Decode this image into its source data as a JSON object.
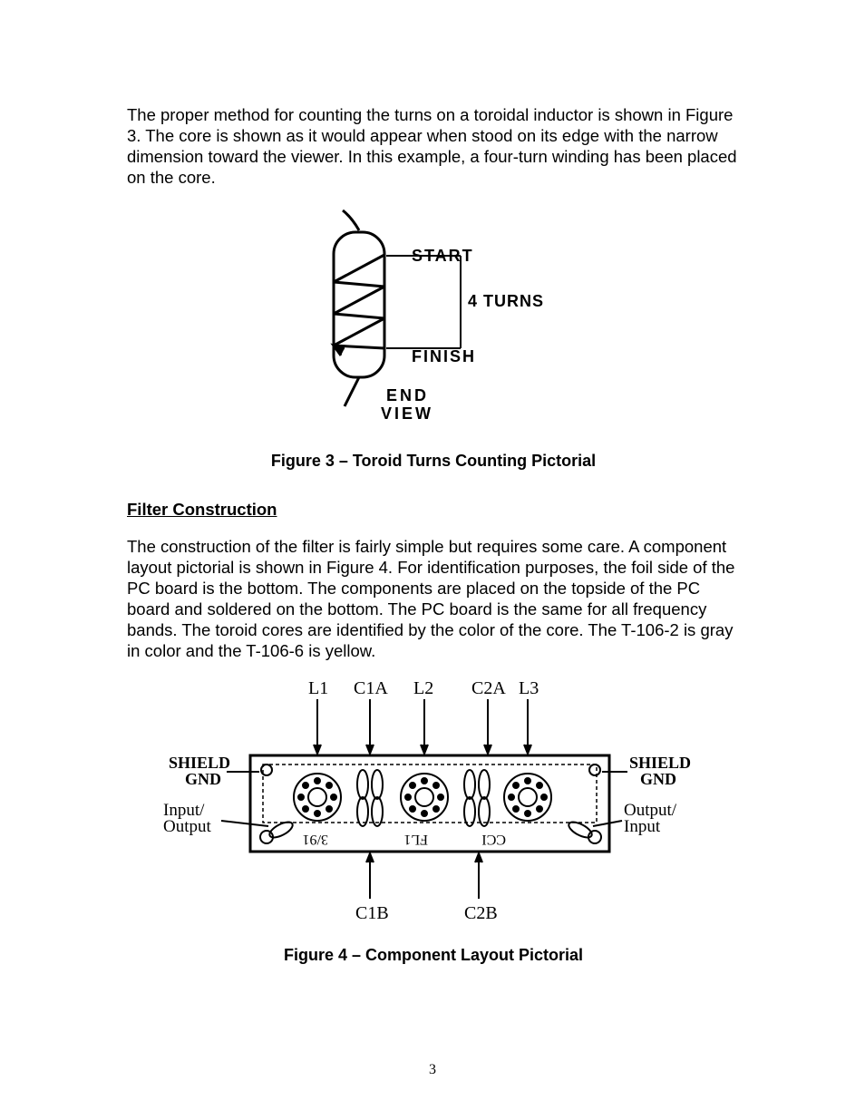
{
  "paragraph1": "The proper method for counting the turns on a toroidal inductor is shown in Figure 3.  The core is shown as it would appear when stood on its edge with the narrow dimension toward the viewer.  In this example, a four-turn winding has been placed on the core.",
  "figure3": {
    "caption": "Figure 3 – Toroid Turns Counting Pictorial",
    "labels": {
      "start": "START",
      "turns": "4 TURNS",
      "finish": "FINISH",
      "end": "END",
      "view": "VIEW"
    }
  },
  "section_heading": "Filter Construction",
  "paragraph2": "The construction of the filter is fairly simple but requires some care.  A component layout pictorial is shown in Figure 4.  For identification purposes, the foil side of the PC board is the bottom.  The components are placed on the topside of the PC board and soldered on the bottom.  The PC board is the same for all frequency bands.  The toroid cores are identified by the color of the core.  The T-106-2 is gray in color and the T-106-6 is yellow.",
  "figure4": {
    "caption": "Figure 4 – Component Layout Pictorial",
    "labels": {
      "L1": "L1",
      "C1A": "C1A",
      "L2": "L2",
      "C2A": "C2A",
      "L3": "L3",
      "shield_left": "SHIELD",
      "gnd_left": "GND",
      "input_left": "Input/",
      "output_left": "Output",
      "shield_right": "SHIELD",
      "gnd_right": "GND",
      "output_right": "Output/",
      "input_right": "Input",
      "C1B": "C1B",
      "C2B": "C2B",
      "board_text1": "3/91",
      "board_text2": "FL1",
      "board_text3": "CCI"
    }
  },
  "page_number": "3"
}
